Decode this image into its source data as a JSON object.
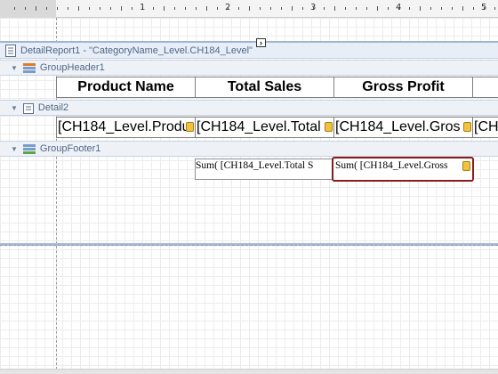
{
  "ruler": {
    "labels": [
      "1",
      "2",
      "3",
      "4",
      "5"
    ]
  },
  "bands": {
    "detail_report": {
      "label": "DetailReport1 - \"CategoryName_Level.CH184_Level\"",
      "smart_tag": "›"
    },
    "group_header": {
      "label": "GroupHeader1"
    },
    "detail": {
      "label": "Detail2"
    },
    "group_footer": {
      "label": "GroupFooter1"
    }
  },
  "header_cells": [
    "Product Name",
    "Total Sales",
    "Gross Profit"
  ],
  "detail_cells": [
    "[CH184_Level.Produ",
    "[CH184_Level.Total",
    "[CH184_Level.Gros",
    "[CH"
  ],
  "footer_cells": [
    "Sum( [CH184_Level.Total S",
    "Sum( [CH184_Level.Gross"
  ],
  "colors": {
    "selection": "#8c1c1c",
    "band_caption": "#4e6786",
    "field_tag": "#f2c23c"
  },
  "icons": {
    "report": "report-icon",
    "group_header": "group-header-icon",
    "detail": "detail-band-icon",
    "group_footer": "group-footer-icon"
  }
}
